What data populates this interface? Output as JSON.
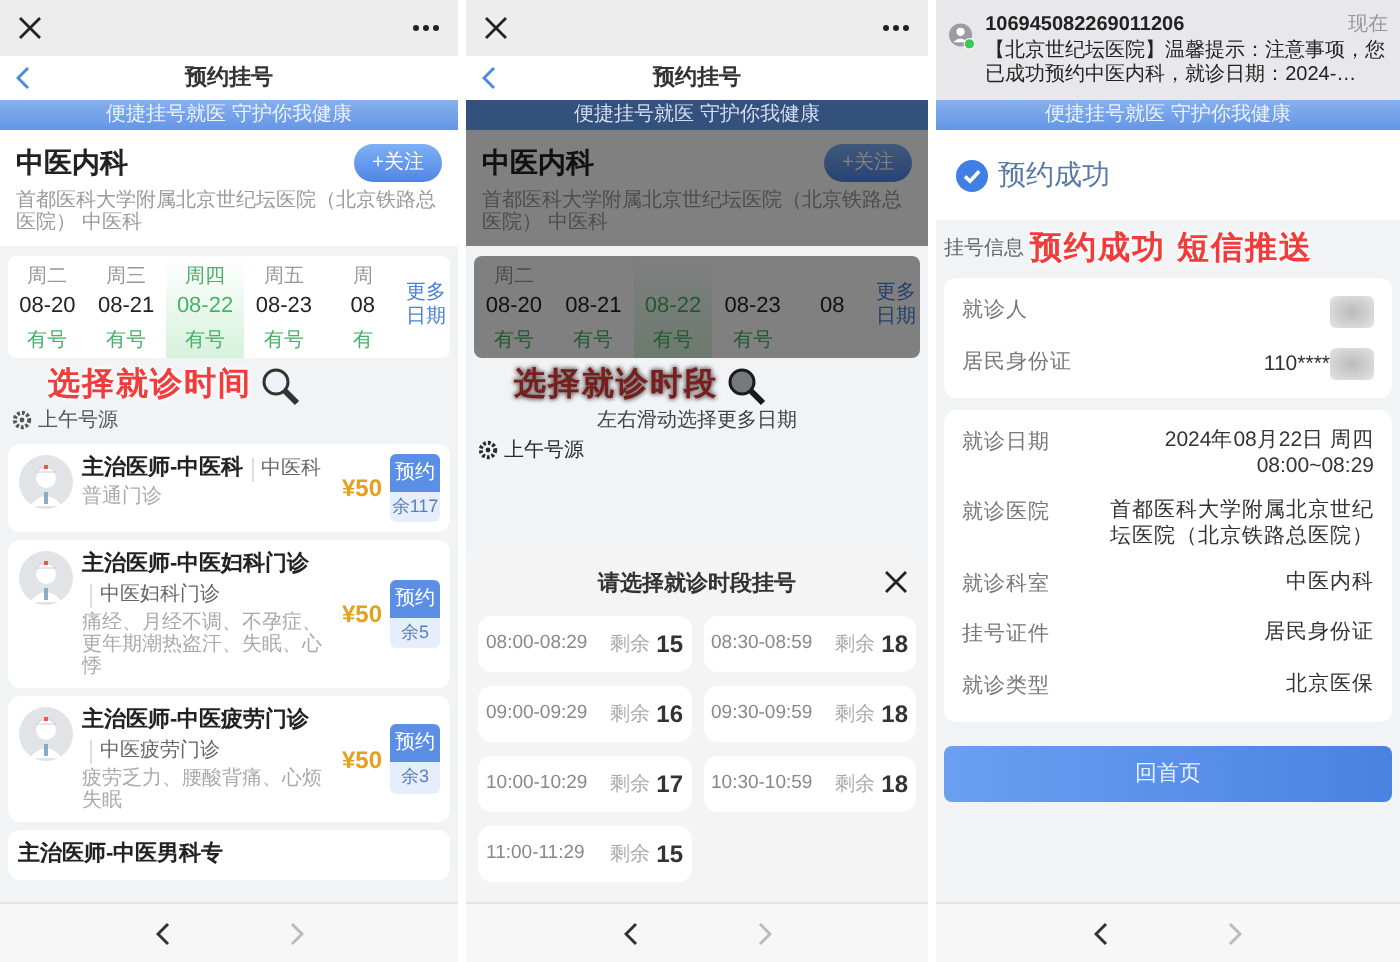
{
  "screens": [
    {
      "kind": "schedule",
      "title": "预约挂号",
      "banner": "便捷挂号就医 守护你我健康",
      "dimmed": false,
      "department": {
        "name": "中医内科",
        "follow_button": "+关注",
        "hospital": "首都医科大学附属北京世纪坛医院（北京铁路总医院） 中医科"
      },
      "dates": [
        {
          "weekday": "周二",
          "date": "08-20",
          "status": "有号",
          "selected": false
        },
        {
          "weekday": "周三",
          "date": "08-21",
          "status": "有号",
          "selected": false
        },
        {
          "weekday": "周四",
          "date": "08-22",
          "status": "有号",
          "selected": true
        },
        {
          "weekday": "周五",
          "date": "08-23",
          "status": "有号",
          "selected": false
        },
        {
          "weekday": "周",
          "date": "08",
          "status": "有",
          "selected": false
        }
      ],
      "more_dates": "更多日期",
      "caption": "选择就诊时间",
      "session": "上午号源",
      "doctors": [
        {
          "title": "主治医师-中医科",
          "dept": "中医科",
          "note": "普通门诊",
          "price": "¥50",
          "book_button": "预约",
          "remaining": "余117"
        },
        {
          "title": "主治医师-中医妇科门诊",
          "dept": "中医妇科门诊",
          "note": "痛经、月经不调、不孕症、更年期潮热盗汗、失眠、心悸",
          "price": "¥50",
          "book_button": "预约",
          "remaining": "余5"
        },
        {
          "title": "主治医师-中医疲劳门诊",
          "dept": "中医疲劳门诊",
          "note": "疲劳乏力、腰酸背痛、心烦失眠",
          "price": "¥50",
          "book_button": "预约",
          "remaining": "余3"
        },
        {
          "title": "主治医师-中医男科专"
        }
      ]
    },
    {
      "kind": "schedule",
      "title": "预约挂号",
      "banner": "便捷挂号就医 守护你我健康",
      "dimmed": true,
      "department": {
        "name": "中医内科",
        "follow_button": "+关注",
        "hospital": "首都医科大学附属北京世纪坛医院（北京铁路总医院） 中医科"
      },
      "dates": [
        {
          "weekday": "周二",
          "date": "08-20",
          "status": "有号",
          "selected": false
        },
        {
          "date": "08-21",
          "status": "有号",
          "selected": false
        },
        {
          "date": "08-22",
          "status": "有号",
          "selected": true
        },
        {
          "date": "08-23",
          "status": "有号",
          "selected": false
        },
        {
          "date": "08",
          "selected": false
        }
      ],
      "more_dates": "更多日期",
      "caption": "选择就诊时段",
      "swipe_hint": "左右滑动选择更多日期",
      "session": "上午号源",
      "sheet": {
        "title": "请选择就诊时段挂号",
        "slots": [
          {
            "time": "08:00-08:29",
            "label": "剩余",
            "count": "15"
          },
          {
            "time": "08:30-08:59",
            "label": "剩余",
            "count": "18"
          },
          {
            "time": "09:00-09:29",
            "label": "剩余",
            "count": "16"
          },
          {
            "time": "09:30-09:59",
            "label": "剩余",
            "count": "18"
          },
          {
            "time": "10:00-10:29",
            "label": "剩余",
            "count": "17"
          },
          {
            "time": "10:30-10:59",
            "label": "剩余",
            "count": "18"
          },
          {
            "time": "11:00-11:29",
            "label": "剩余",
            "count": "15"
          }
        ]
      }
    },
    {
      "kind": "confirmation",
      "notification": {
        "sender": "106945082269011206",
        "time": "现在",
        "message": "【北京世纪坛医院】温馨提示：注意事项，您已成功预约中医内科，就诊日期：2024-…"
      },
      "banner": "便捷挂号就医 守护你我健康",
      "status": "预约成功",
      "section_label": "挂号信息",
      "caption": "预约成功 短信推送",
      "patient_rows": [
        {
          "kind": "blurred",
          "label": "就诊人"
        },
        {
          "kind": "masked",
          "label": "居民身份证",
          "value": "110****"
        }
      ],
      "detail_rows": [
        {
          "label": "就诊日期",
          "value": "2024年08月22日 周四",
          "time": "08:00~08:29"
        },
        {
          "label": "就诊医院",
          "value": "首都医科大学附属北京世纪坛医院（北京铁路总医院）"
        },
        {
          "label": "就诊科室",
          "value": "中医内科"
        },
        {
          "label": "挂号证件",
          "value": "居民身份证"
        },
        {
          "label": "就诊类型",
          "value": "北京医保"
        }
      ],
      "home_button": "回首页"
    }
  ]
}
